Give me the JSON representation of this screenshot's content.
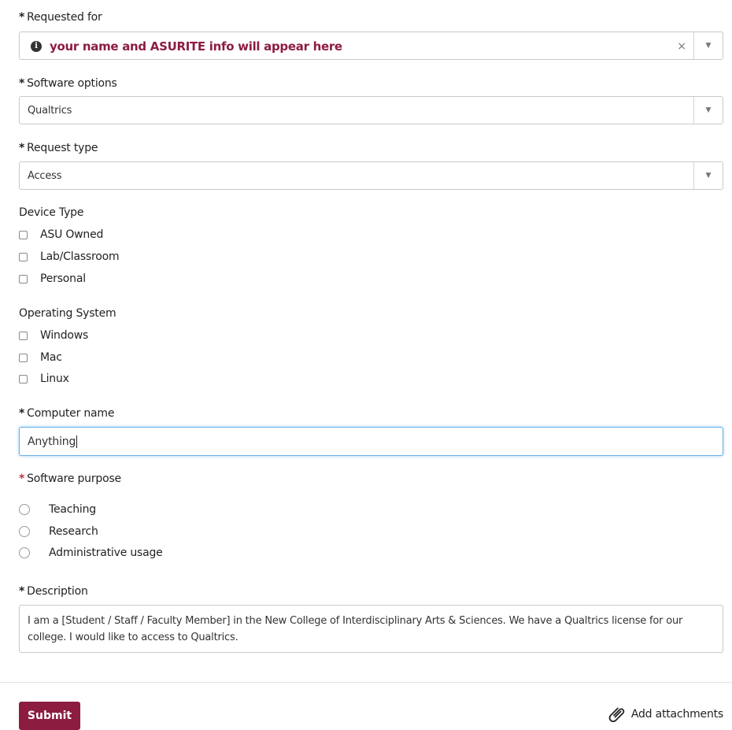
{
  "form": {
    "requested_for": {
      "required_mark": "*",
      "label": "Requested for",
      "info_icon": "info-circle-icon",
      "value": "your name and ASURITE info will appear here",
      "clear_glyph": "×",
      "arrow_glyph": "▼"
    },
    "software_options": {
      "required_mark": "*",
      "label": "Software options",
      "value": "Qualtrics",
      "arrow_glyph": "▼"
    },
    "request_type": {
      "required_mark": "*",
      "label": "Request type",
      "value": "Access",
      "arrow_glyph": "▼"
    },
    "device_type": {
      "label": "Device Type",
      "options": [
        {
          "label": "ASU Owned",
          "checked": false
        },
        {
          "label": "Lab/Classroom",
          "checked": false
        },
        {
          "label": "Personal",
          "checked": false
        }
      ]
    },
    "operating_system": {
      "label": "Operating System",
      "options": [
        {
          "label": "Windows",
          "checked": false
        },
        {
          "label": "Mac",
          "checked": false
        },
        {
          "label": "Linux",
          "checked": false
        }
      ]
    },
    "computer_name": {
      "required_mark": "*",
      "label": "Computer name",
      "value": "Anything"
    },
    "software_purpose": {
      "required_mark": "*",
      "label": "Software purpose",
      "options": [
        {
          "label": "Teaching",
          "selected": false
        },
        {
          "label": "Research",
          "selected": false
        },
        {
          "label": "Administrative usage",
          "selected": false
        }
      ]
    },
    "description": {
      "required_mark": "*",
      "label": "Description",
      "value": "I am a [Student / Staff / Faculty Member] in the New College of Interdisciplinary Arts & Sciences. We have a Qualtrics license for our college. I would like to access to Qualtrics."
    }
  },
  "footer": {
    "submit_label": "Submit",
    "attach_label": "Add attachments",
    "attach_icon": "paperclip-icon"
  },
  "colors": {
    "brand": "#8c1d40",
    "required_red": "#c5303b",
    "focus_border": "#66afe9"
  }
}
